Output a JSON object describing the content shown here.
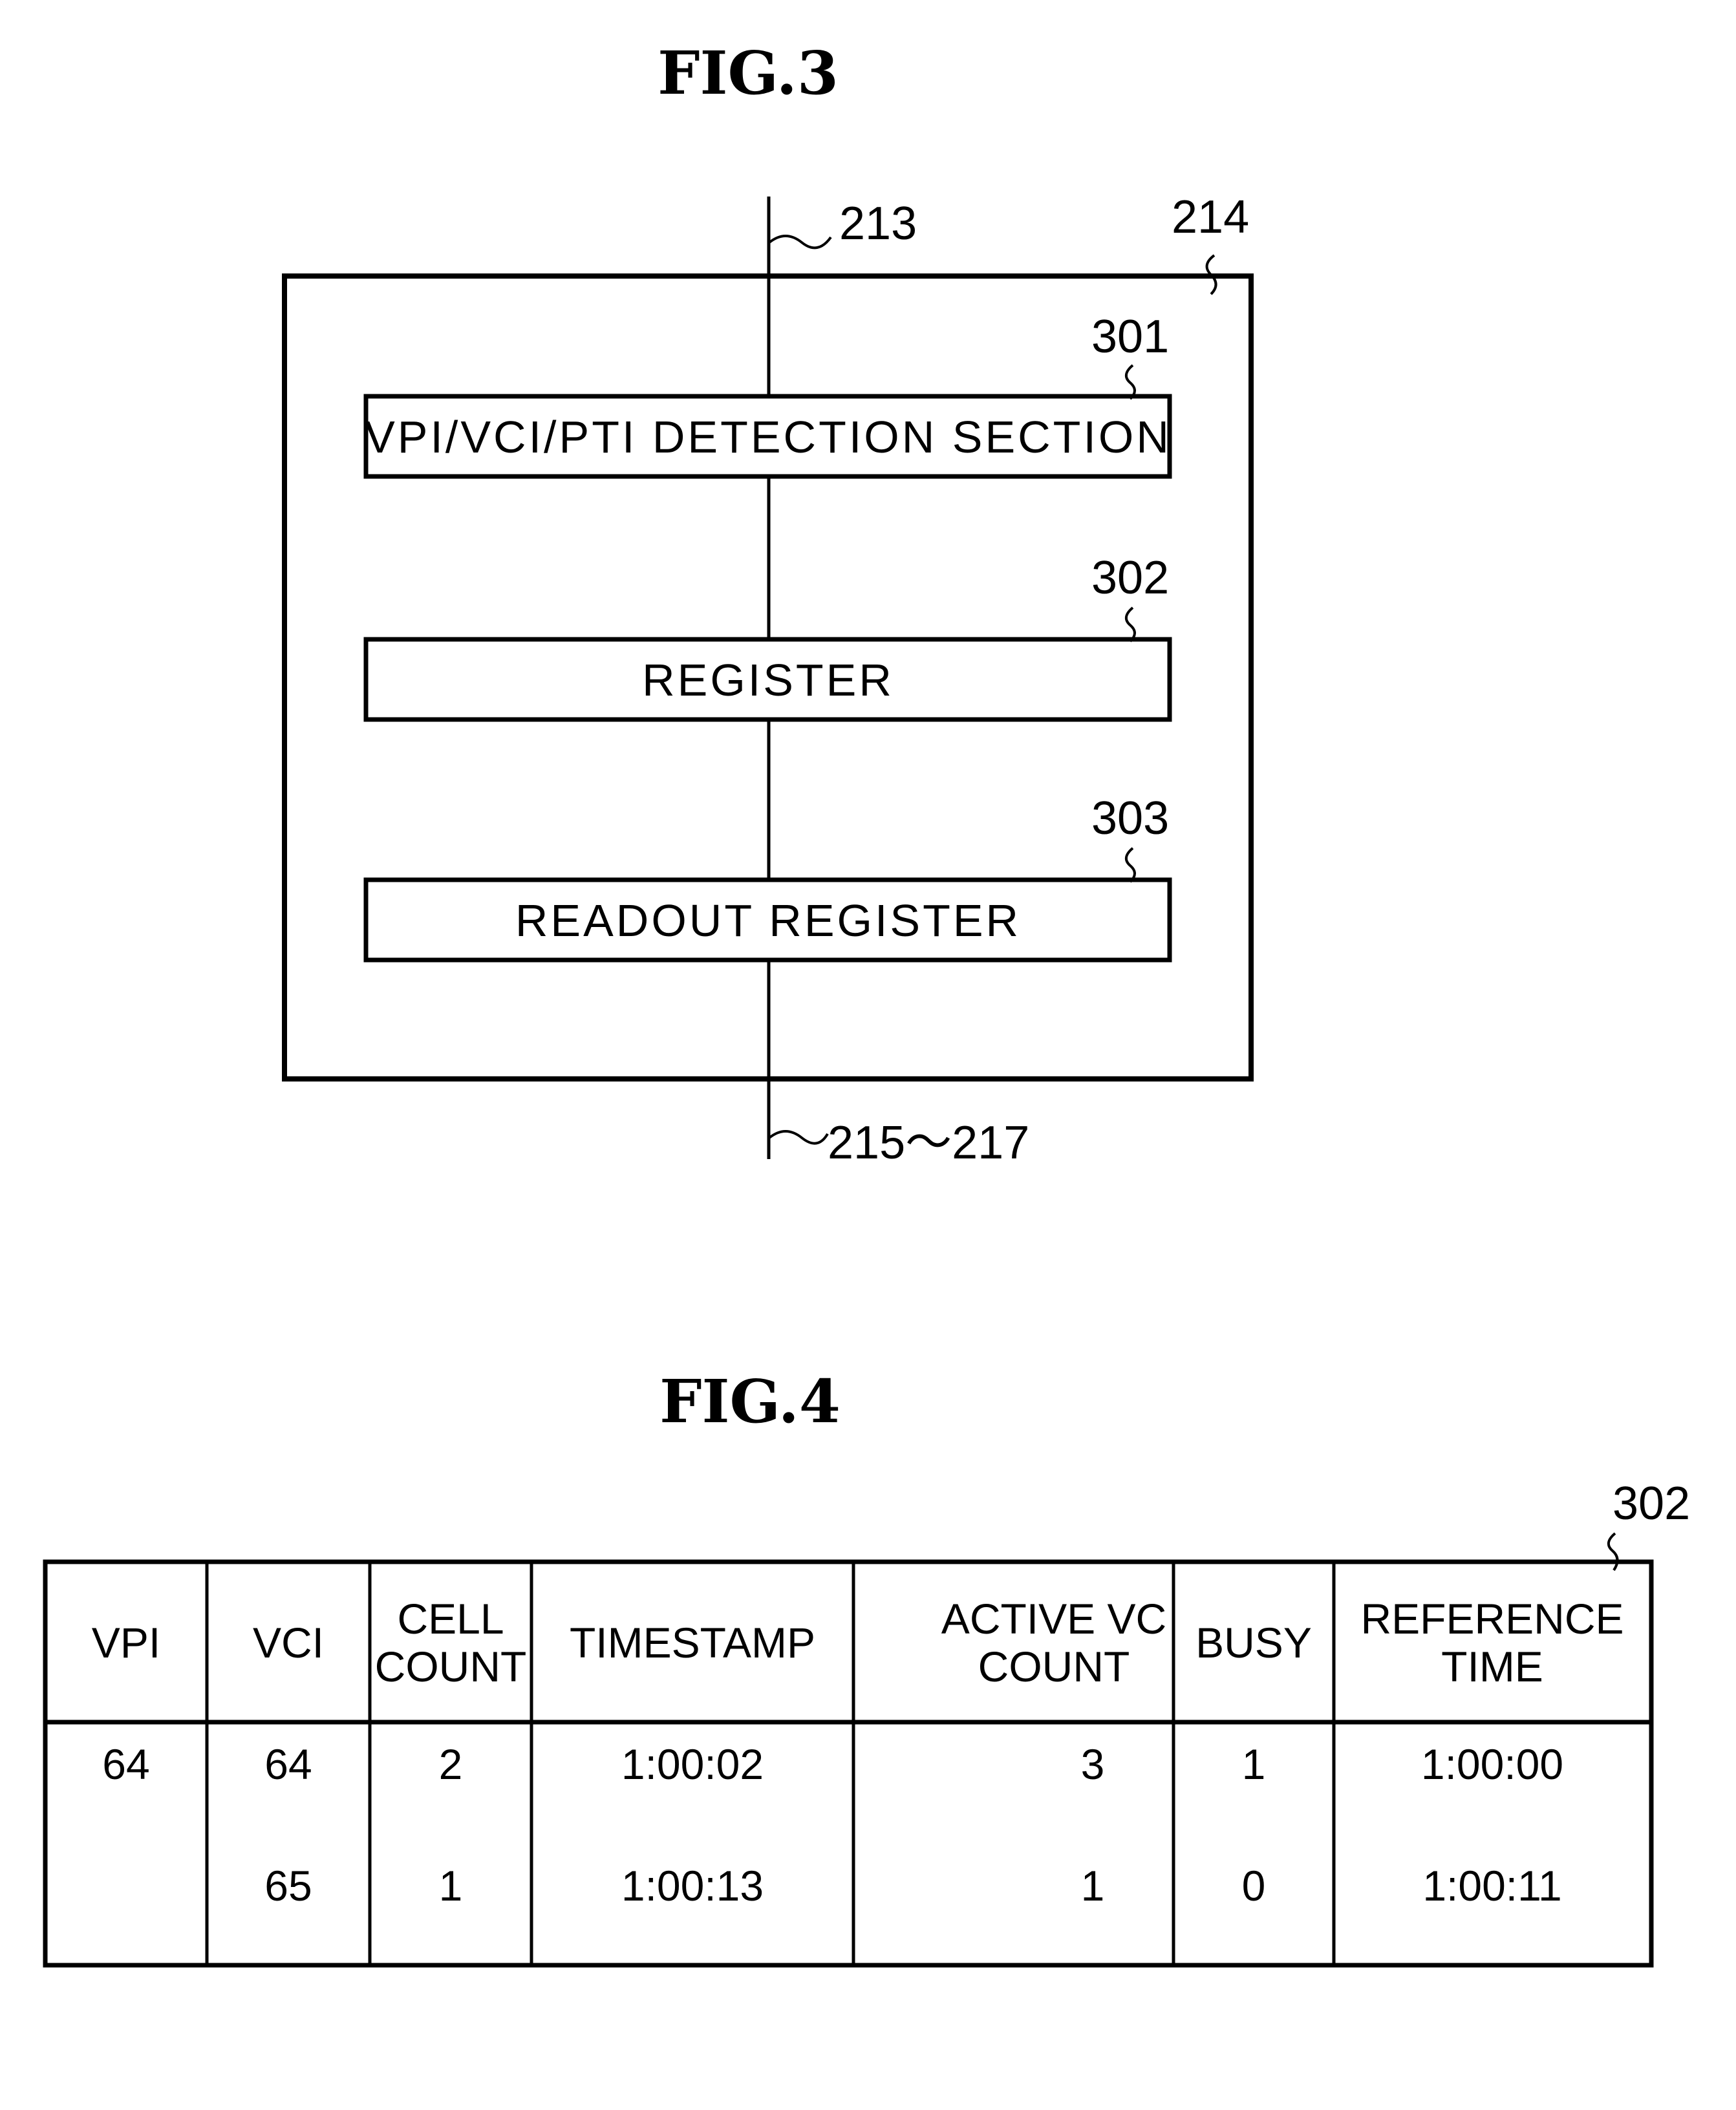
{
  "fig3": {
    "title": "FIG.3",
    "input_ref": "213",
    "container_ref": "214",
    "output_ref": "215～217",
    "blocks": [
      {
        "ref": "301",
        "label": "VPI/VCI/PTI DETECTION SECTION"
      },
      {
        "ref": "302",
        "label": "REGISTER"
      },
      {
        "ref": "303",
        "label": "READOUT REGISTER"
      }
    ]
  },
  "fig4": {
    "title": "FIG.4",
    "table_ref": "302",
    "headers": [
      [
        "VPI"
      ],
      [
        "VCI"
      ],
      [
        "CELL",
        "COUNT"
      ],
      [
        "TIMESTAMP"
      ],
      [
        "ACTIVE VC",
        "COUNT"
      ],
      [
        "BUSY"
      ],
      [
        "REFERENCE",
        "TIME"
      ]
    ],
    "rows": [
      [
        "64",
        "64",
        "2",
        "1:00:02",
        "3",
        "1",
        "1:00:00"
      ],
      [
        "",
        "65",
        "1",
        "1:00:13",
        "1",
        "0",
        "1:00:11"
      ]
    ]
  }
}
